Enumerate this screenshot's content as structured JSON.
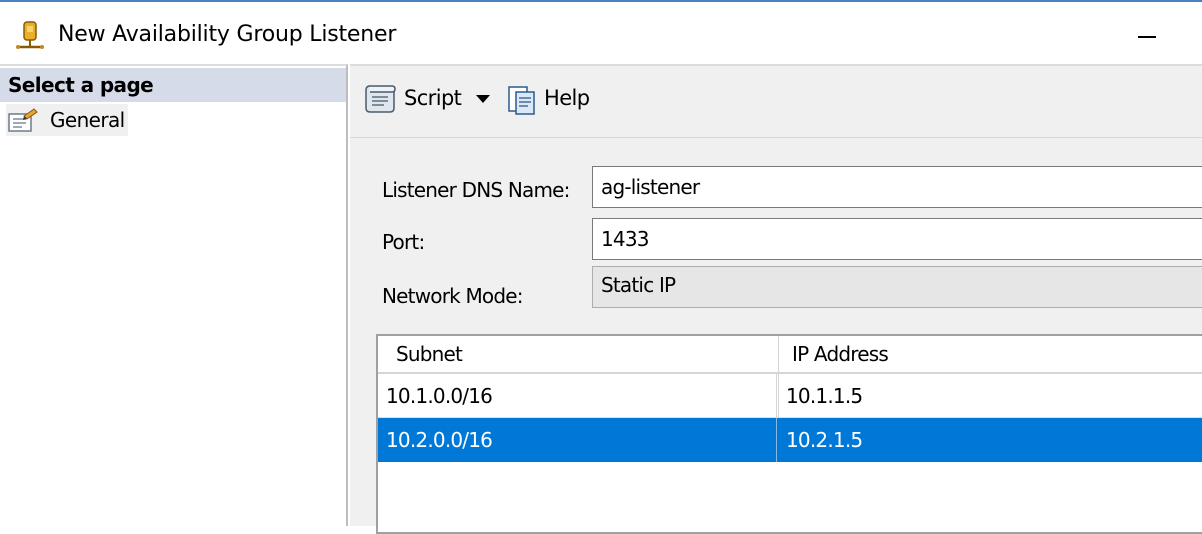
{
  "window": {
    "title": "New Availability Group Listener",
    "icon": "availability-group-listener-icon"
  },
  "sidebar": {
    "header": "Select a page",
    "items": [
      {
        "label": "General",
        "icon": "properties-page-icon"
      }
    ]
  },
  "toolbar": {
    "script_label": "Script",
    "help_label": "Help"
  },
  "form": {
    "dns_name_label": "Listener DNS Name:",
    "dns_name_value": "ag-listener",
    "port_label": "Port:",
    "port_value": "1433",
    "network_mode_label": "Network Mode:",
    "network_mode_value": "Static IP"
  },
  "ip_table": {
    "columns": [
      "Subnet",
      "IP Address"
    ],
    "rows": [
      {
        "subnet": "10.1.0.0/16",
        "ip": "10.1.1.5",
        "selected": false
      },
      {
        "subnet": "10.2.0.0/16",
        "ip": "10.2.1.5",
        "selected": true
      }
    ]
  },
  "colors": {
    "selection": "#0078d7",
    "page_header": "#d6dbe9",
    "panel_bg": "#f0f0f0"
  }
}
